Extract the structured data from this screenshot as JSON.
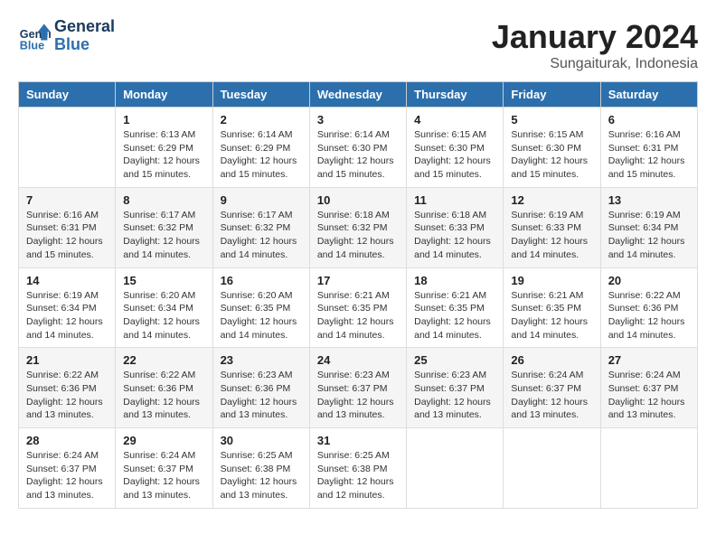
{
  "header": {
    "logo_line1": "General",
    "logo_line2": "Blue",
    "month_year": "January 2024",
    "location": "Sungaiturak, Indonesia"
  },
  "days_of_week": [
    "Sunday",
    "Monday",
    "Tuesday",
    "Wednesday",
    "Thursday",
    "Friday",
    "Saturday"
  ],
  "weeks": [
    [
      {
        "day": "",
        "info": ""
      },
      {
        "day": "1",
        "info": "Sunrise: 6:13 AM\nSunset: 6:29 PM\nDaylight: 12 hours\nand 15 minutes."
      },
      {
        "day": "2",
        "info": "Sunrise: 6:14 AM\nSunset: 6:29 PM\nDaylight: 12 hours\nand 15 minutes."
      },
      {
        "day": "3",
        "info": "Sunrise: 6:14 AM\nSunset: 6:30 PM\nDaylight: 12 hours\nand 15 minutes."
      },
      {
        "day": "4",
        "info": "Sunrise: 6:15 AM\nSunset: 6:30 PM\nDaylight: 12 hours\nand 15 minutes."
      },
      {
        "day": "5",
        "info": "Sunrise: 6:15 AM\nSunset: 6:30 PM\nDaylight: 12 hours\nand 15 minutes."
      },
      {
        "day": "6",
        "info": "Sunrise: 6:16 AM\nSunset: 6:31 PM\nDaylight: 12 hours\nand 15 minutes."
      }
    ],
    [
      {
        "day": "7",
        "info": "Sunrise: 6:16 AM\nSunset: 6:31 PM\nDaylight: 12 hours\nand 15 minutes."
      },
      {
        "day": "8",
        "info": "Sunrise: 6:17 AM\nSunset: 6:32 PM\nDaylight: 12 hours\nand 14 minutes."
      },
      {
        "day": "9",
        "info": "Sunrise: 6:17 AM\nSunset: 6:32 PM\nDaylight: 12 hours\nand 14 minutes."
      },
      {
        "day": "10",
        "info": "Sunrise: 6:18 AM\nSunset: 6:32 PM\nDaylight: 12 hours\nand 14 minutes."
      },
      {
        "day": "11",
        "info": "Sunrise: 6:18 AM\nSunset: 6:33 PM\nDaylight: 12 hours\nand 14 minutes."
      },
      {
        "day": "12",
        "info": "Sunrise: 6:19 AM\nSunset: 6:33 PM\nDaylight: 12 hours\nand 14 minutes."
      },
      {
        "day": "13",
        "info": "Sunrise: 6:19 AM\nSunset: 6:34 PM\nDaylight: 12 hours\nand 14 minutes."
      }
    ],
    [
      {
        "day": "14",
        "info": "Sunrise: 6:19 AM\nSunset: 6:34 PM\nDaylight: 12 hours\nand 14 minutes."
      },
      {
        "day": "15",
        "info": "Sunrise: 6:20 AM\nSunset: 6:34 PM\nDaylight: 12 hours\nand 14 minutes."
      },
      {
        "day": "16",
        "info": "Sunrise: 6:20 AM\nSunset: 6:35 PM\nDaylight: 12 hours\nand 14 minutes."
      },
      {
        "day": "17",
        "info": "Sunrise: 6:21 AM\nSunset: 6:35 PM\nDaylight: 12 hours\nand 14 minutes."
      },
      {
        "day": "18",
        "info": "Sunrise: 6:21 AM\nSunset: 6:35 PM\nDaylight: 12 hours\nand 14 minutes."
      },
      {
        "day": "19",
        "info": "Sunrise: 6:21 AM\nSunset: 6:35 PM\nDaylight: 12 hours\nand 14 minutes."
      },
      {
        "day": "20",
        "info": "Sunrise: 6:22 AM\nSunset: 6:36 PM\nDaylight: 12 hours\nand 14 minutes."
      }
    ],
    [
      {
        "day": "21",
        "info": "Sunrise: 6:22 AM\nSunset: 6:36 PM\nDaylight: 12 hours\nand 13 minutes."
      },
      {
        "day": "22",
        "info": "Sunrise: 6:22 AM\nSunset: 6:36 PM\nDaylight: 12 hours\nand 13 minutes."
      },
      {
        "day": "23",
        "info": "Sunrise: 6:23 AM\nSunset: 6:36 PM\nDaylight: 12 hours\nand 13 minutes."
      },
      {
        "day": "24",
        "info": "Sunrise: 6:23 AM\nSunset: 6:37 PM\nDaylight: 12 hours\nand 13 minutes."
      },
      {
        "day": "25",
        "info": "Sunrise: 6:23 AM\nSunset: 6:37 PM\nDaylight: 12 hours\nand 13 minutes."
      },
      {
        "day": "26",
        "info": "Sunrise: 6:24 AM\nSunset: 6:37 PM\nDaylight: 12 hours\nand 13 minutes."
      },
      {
        "day": "27",
        "info": "Sunrise: 6:24 AM\nSunset: 6:37 PM\nDaylight: 12 hours\nand 13 minutes."
      }
    ],
    [
      {
        "day": "28",
        "info": "Sunrise: 6:24 AM\nSunset: 6:37 PM\nDaylight: 12 hours\nand 13 minutes."
      },
      {
        "day": "29",
        "info": "Sunrise: 6:24 AM\nSunset: 6:37 PM\nDaylight: 12 hours\nand 13 minutes."
      },
      {
        "day": "30",
        "info": "Sunrise: 6:25 AM\nSunset: 6:38 PM\nDaylight: 12 hours\nand 13 minutes."
      },
      {
        "day": "31",
        "info": "Sunrise: 6:25 AM\nSunset: 6:38 PM\nDaylight: 12 hours\nand 12 minutes."
      },
      {
        "day": "",
        "info": ""
      },
      {
        "day": "",
        "info": ""
      },
      {
        "day": "",
        "info": ""
      }
    ]
  ]
}
